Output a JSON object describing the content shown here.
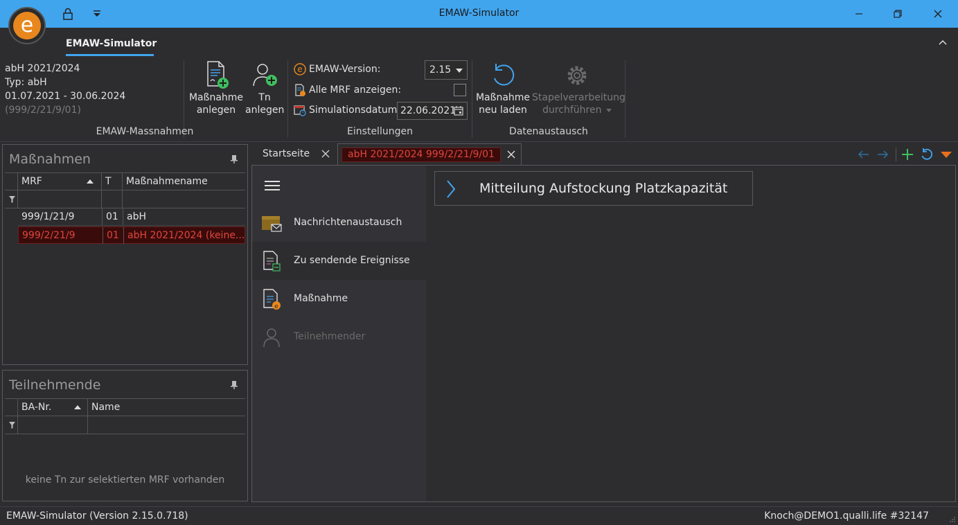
{
  "window": {
    "title": "EMAW-Simulator"
  },
  "ribbon": {
    "tab_label": "EMAW-Simulator",
    "info": {
      "line1": "abH 2021/2024",
      "line2": "Typ: abH",
      "line3": "01.07.2021 - 30.06.2024",
      "line4": "(999/2/21/9/01)"
    },
    "groups": {
      "massnahmen": "EMAW-Massnahmen",
      "einstellungen": "Einstellungen",
      "datenaustausch": "Datenaustausch"
    },
    "buttons": {
      "massnahme_anlegen_1": "Maßnahme",
      "massnahme_anlegen_2": "anlegen",
      "tn_anlegen_1": "Tn",
      "tn_anlegen_2": "anlegen",
      "neu_laden_1": "Maßnahme",
      "neu_laden_2": "neu laden",
      "stapel_1": "Stapelverarbeitung",
      "stapel_2": "durchführen"
    },
    "settings": {
      "version_label": "EMAW-Version:",
      "version_value": "2.15",
      "alle_mrf_label": "Alle MRF anzeigen:",
      "sim_datum_label": "Simulationsdatum:",
      "sim_datum_value": "22.06.2021"
    }
  },
  "massnahmen_panel": {
    "title": "Maßnahmen",
    "columns": [
      "MRF",
      "T",
      "Maßnahmename"
    ],
    "rows": [
      {
        "mrf": "999/1/21/9",
        "t": "01",
        "name": "abH"
      },
      {
        "mrf": "999/2/21/9",
        "t": "01",
        "name": "abH 2021/2024 (keine..."
      }
    ]
  },
  "teilnehmende_panel": {
    "title": "Teilnehmende",
    "columns": [
      "BA-Nr.",
      "Name"
    ],
    "empty_text": "keine Tn zur selektierten MRF vorhanden"
  },
  "doc_tabs": {
    "tab1": "Startseite",
    "tab2": "abH 2021/2024 999/2/21/9/01"
  },
  "sidenav": {
    "items": [
      {
        "label": "Nachrichtenaustausch"
      },
      {
        "label": "Zu sendende Ereignisse"
      },
      {
        "label": "Maßnahme"
      },
      {
        "label": "Teilnehmender"
      }
    ]
  },
  "content": {
    "expander_label": "Mitteilung Aufstockung Platzkapazität"
  },
  "statusbar": {
    "left": "EMAW-Simulator (Version 2.15.0.718)",
    "right": "Knoch@DEMO1.qualli.life  #32147"
  },
  "colors": {
    "titlebar": "#41a5ee",
    "accent": "#41a5ee",
    "selected_text": "#e0463c",
    "logo_orange": "#e8871e",
    "add_green": "#3fbf5f",
    "menu_orange": "#e8701e"
  }
}
